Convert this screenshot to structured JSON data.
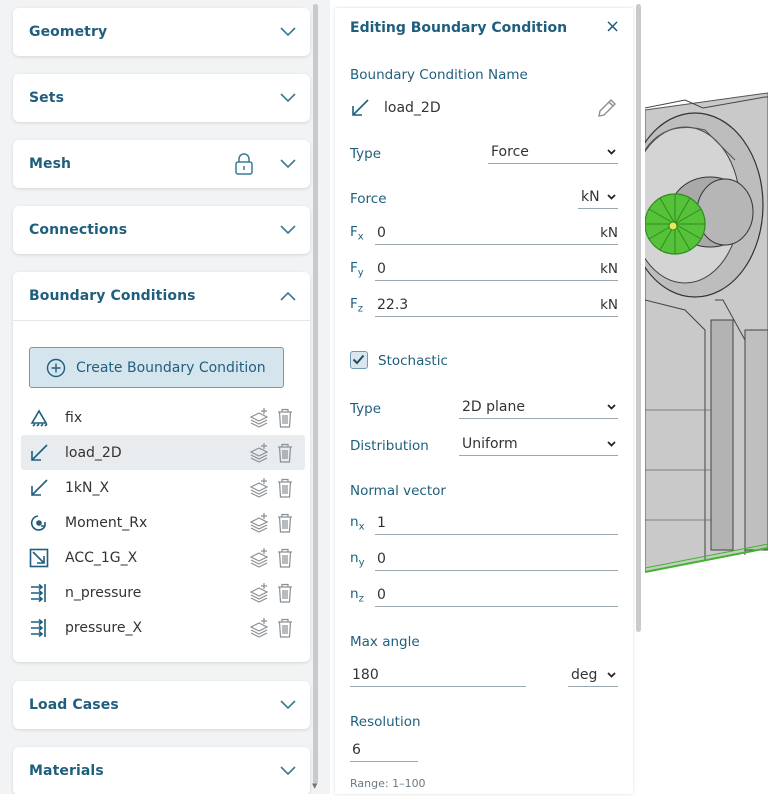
{
  "sidebar": {
    "sections": {
      "geometry": "Geometry",
      "sets": "Sets",
      "mesh": "Mesh",
      "connections": "Connections",
      "boundary_conditions": "Boundary Conditions",
      "load_cases": "Load Cases",
      "materials": "Materials"
    },
    "create_button": "Create Boundary Condition",
    "bc_items": [
      {
        "label": "fix",
        "icon": "fixed-support-icon"
      },
      {
        "label": "load_2D",
        "icon": "force-arrow-icon",
        "selected": true
      },
      {
        "label": "1kN_X",
        "icon": "force-arrow-icon"
      },
      {
        "label": "Moment_Rx",
        "icon": "moment-icon"
      },
      {
        "label": "ACC_1G_X",
        "icon": "acceleration-icon"
      },
      {
        "label": "n_pressure",
        "icon": "pressure-icon"
      },
      {
        "label": "pressure_X",
        "icon": "pressure-icon"
      }
    ]
  },
  "editor": {
    "title": "Editing Boundary Condition",
    "close_icon": "×",
    "name_label": "Boundary Condition Name",
    "name_value": "load_2D",
    "type_label": "Type",
    "type_value": "Force",
    "force_label": "Force",
    "force_unit": "kN",
    "fx": {
      "sym": "F",
      "sub": "x",
      "value": "0",
      "unit": "kN"
    },
    "fy": {
      "sym": "F",
      "sub": "y",
      "value": "0",
      "unit": "kN"
    },
    "fz": {
      "sym": "F",
      "sub": "z",
      "value": "22.3",
      "unit": "kN"
    },
    "stochastic_label": "Stochastic",
    "stochastic_checked": true,
    "stoch_type_label": "Type",
    "stoch_type_value": "2D plane",
    "distribution_label": "Distribution",
    "distribution_value": "Uniform",
    "normal_label": "Normal vector",
    "nx": {
      "sym": "n",
      "sub": "x",
      "value": "1"
    },
    "ny": {
      "sym": "n",
      "sub": "y",
      "value": "0"
    },
    "nz": {
      "sym": "n",
      "sub": "z",
      "value": "0"
    },
    "max_angle_label": "Max angle",
    "max_angle_value": "180",
    "max_angle_unit": "deg",
    "resolution_label": "Resolution",
    "resolution_value": "6",
    "resolution_hint": "Range: 1–100"
  },
  "colors": {
    "accent": "#1f5f7d",
    "selected_row": "#e8ecef",
    "button_bg": "#d5e5ee",
    "highlight_green": "#3fb529"
  }
}
